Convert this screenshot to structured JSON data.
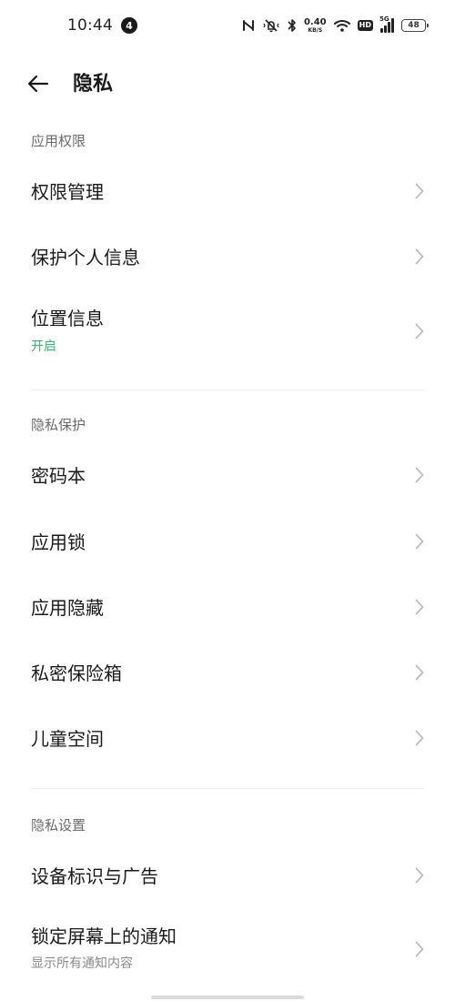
{
  "status_bar": {
    "time": "10:44",
    "notification_count": "4",
    "net_speed_value": "0.40",
    "net_speed_unit": "KB/S",
    "hd_label": "HD",
    "network_label": "5G",
    "battery_level": "48"
  },
  "header": {
    "title": "隐私"
  },
  "sections": {
    "app_permissions": {
      "header": "应用权限",
      "items": [
        {
          "label": "权限管理"
        },
        {
          "label": "保护个人信息"
        },
        {
          "label": "位置信息",
          "sub": "开启"
        }
      ]
    },
    "privacy_protection": {
      "header": "隐私保护",
      "items": [
        {
          "label": "密码本"
        },
        {
          "label": "应用锁"
        },
        {
          "label": "应用隐藏"
        },
        {
          "label": "私密保险箱"
        },
        {
          "label": "儿童空间"
        }
      ]
    },
    "privacy_settings": {
      "header": "隐私设置",
      "items": [
        {
          "label": "设备标识与广告"
        },
        {
          "label": "锁定屏幕上的通知",
          "sub": "显示所有通知内容"
        }
      ]
    }
  },
  "colors": {
    "accent_green": "#2ebd6b",
    "subtext_gray": "#8a8a8a",
    "section_gray": "#6a6a6a",
    "chevron_gray": "#bdbdbd"
  }
}
